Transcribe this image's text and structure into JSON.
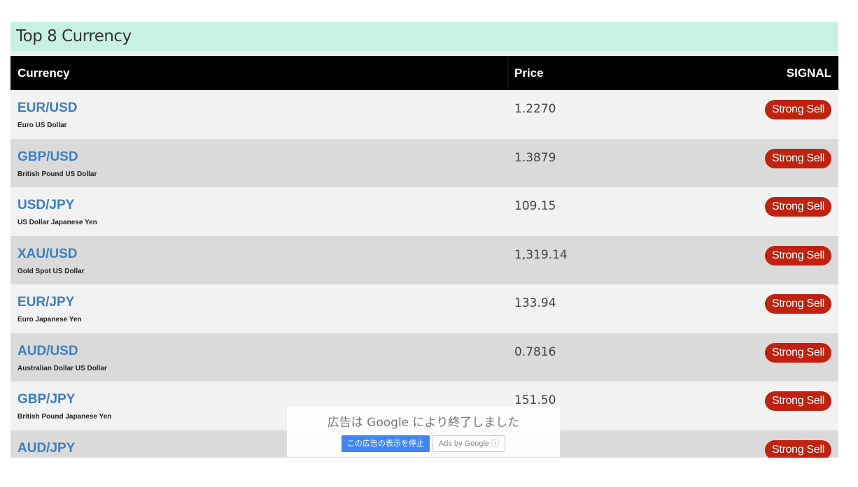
{
  "widget": {
    "title": "Top 8 Currency",
    "headers": {
      "currency": "Currency",
      "price": "Price",
      "signal": "SIGNAL"
    },
    "rows": [
      {
        "pair": "EUR/USD",
        "name": "Euro US Dollar",
        "price": "1.2270",
        "signal": "Strong Sell"
      },
      {
        "pair": "GBP/USD",
        "name": "British Pound US Dollar",
        "price": "1.3879",
        "signal": "Strong Sell"
      },
      {
        "pair": "USD/JPY",
        "name": "US Dollar Japanese Yen",
        "price": "109.15",
        "signal": "Strong Sell"
      },
      {
        "pair": "XAU/USD",
        "name": "Gold Spot US Dollar",
        "price": "1,319.14",
        "signal": "Strong Sell"
      },
      {
        "pair": "EUR/JPY",
        "name": "Euro Japanese Yen",
        "price": "133.94",
        "signal": "Strong Sell"
      },
      {
        "pair": "AUD/USD",
        "name": "Australian Dollar US Dollar",
        "price": "0.7816",
        "signal": "Strong Sell"
      },
      {
        "pair": "GBP/JPY",
        "name": "British Pound Japanese Yen",
        "price": "151.50",
        "signal": "Strong Sell"
      },
      {
        "pair": "AUD/JPY",
        "name": "",
        "price": "",
        "signal": "Strong Sell"
      }
    ]
  },
  "ad": {
    "message": "広告は Google により終了しました",
    "stop_label": "この広告の表示を停止",
    "ads_by_label": "Ads by Google ⓘ"
  },
  "colors": {
    "title_bg": "#c8f1e6",
    "header_bg": "#000000",
    "pair_link": "#3a7fc1",
    "signal_bg": "#c0220e",
    "row_light": "#f2f2f2",
    "row_dark": "#dadada"
  }
}
